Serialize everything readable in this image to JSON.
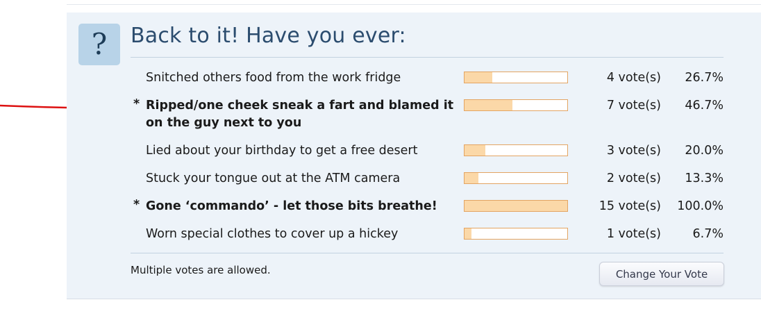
{
  "poll": {
    "icon_glyph": "?",
    "title": "Back to it! Have you ever:",
    "options": [
      {
        "marker": "",
        "text": "Snitched others food from the work fridge",
        "votes": "4 vote(s)",
        "percent": "26.7%",
        "fill_percent": 26.7,
        "voted": false
      },
      {
        "marker": "*",
        "text": "Ripped/one cheek sneak a fart and blamed it on the guy next to you",
        "votes": "7 vote(s)",
        "percent": "46.7%",
        "fill_percent": 46.7,
        "voted": true
      },
      {
        "marker": "",
        "text": "Lied about your birthday to get a free desert",
        "votes": "3 vote(s)",
        "percent": "20.0%",
        "fill_percent": 20.0,
        "voted": false
      },
      {
        "marker": "",
        "text": "Stuck your tongue out at the ATM camera",
        "votes": "2 vote(s)",
        "percent": "13.3%",
        "fill_percent": 13.3,
        "voted": false
      },
      {
        "marker": "*",
        "text": "Gone ‘commando’ - let those bits breathe!",
        "votes": "15 vote(s)",
        "percent": "100.0%",
        "fill_percent": 100.0,
        "voted": true
      },
      {
        "marker": "",
        "text": "Worn special clothes to cover up a hickey",
        "votes": "1 vote(s)",
        "percent": "6.7%",
        "fill_percent": 6.7,
        "voted": false
      }
    ],
    "note": "Multiple votes are allowed.",
    "change_vote_label": "Change Your Vote"
  },
  "colors": {
    "panel_bg": "#edf3f9",
    "title": "#2b4c6e",
    "bar_fill": "#fbd8a8",
    "bar_border": "#e3a462",
    "annotation": "#dd1111"
  }
}
